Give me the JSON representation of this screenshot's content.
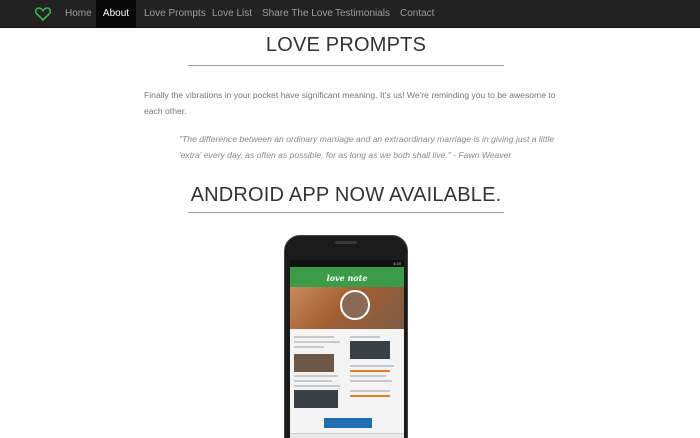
{
  "nav": {
    "brand_icon": "heart-icon",
    "brand_color": "#3bb54a",
    "items": [
      {
        "label": "Home"
      },
      {
        "label": "About",
        "active": true
      },
      {
        "label": "Love Prompts"
      },
      {
        "label": "Love List"
      },
      {
        "label": "Share The Love"
      },
      {
        "label": "Testimonials"
      },
      {
        "label": "Contact"
      }
    ]
  },
  "section1": {
    "title": "LOVE PROMPTS",
    "intro": "Finally the vibrations in your pocket have significant meaning. It's us! We're reminding you to be awesome to each other.",
    "quote": "\"The difference between an ordinary marriage and an extraordinary marriage is in giving just a little 'extra' every day, as often as possible, for as long as we both shall live.\" - Fawn Weaver"
  },
  "section2": {
    "title": "ANDROID APP NOW AVAILABLE."
  },
  "phone": {
    "status_time": "4:20",
    "app_name": "love note",
    "accent_color": "#3b9b48"
  }
}
